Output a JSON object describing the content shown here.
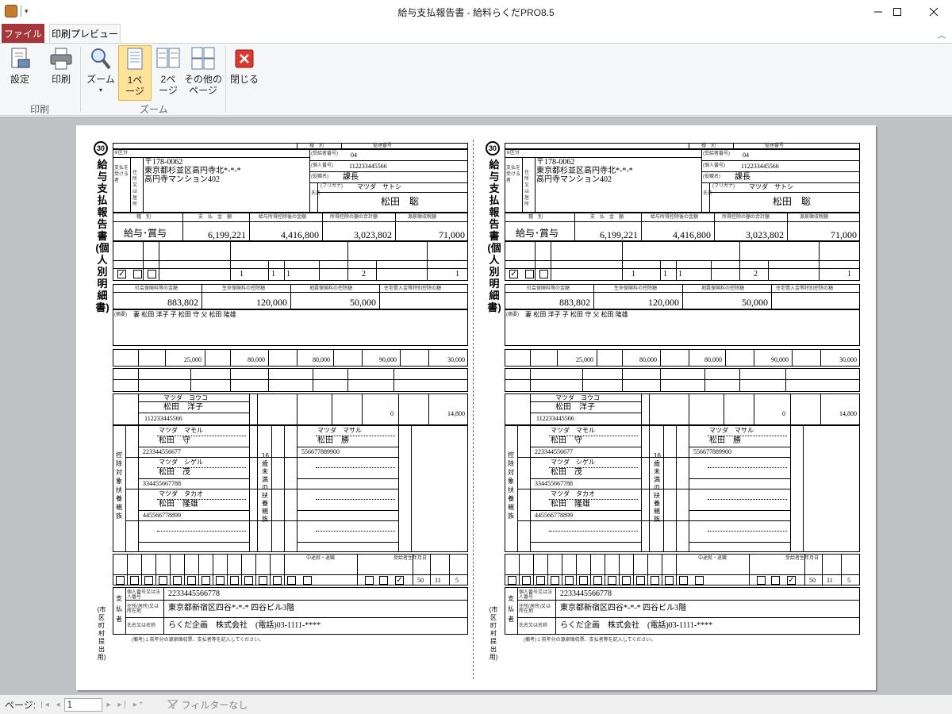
{
  "window": {
    "title": "給与支払報告書 - 給料らくだPRO8.5"
  },
  "tabs": {
    "file": "ファイル",
    "preview": "印刷プレビュー"
  },
  "ribbon": {
    "buttons": {
      "setup": "設定",
      "print": "印刷",
      "zoom": "ズーム",
      "one_page": "1ペ\nージ",
      "two_pages": "2ペ\nージ",
      "other_pages": "その他の\nページ",
      "close": "閉じる"
    },
    "groups": {
      "print": "印刷",
      "zoom": "ズーム"
    }
  },
  "statusbar": {
    "page_label": "ページ:",
    "page_value": "1",
    "filter": "フィルターなし"
  },
  "report": {
    "form_number": "30",
    "title": "給与支払報告書(個人別明細書)",
    "side_label": "(市区町村提出用)",
    "header_cols": {
      "c1": "種　別",
      "c2": "整理番号"
    },
    "labels": {
      "kubun": "※区分",
      "recipient_side": "支払を受ける者",
      "address": "住所又は居所",
      "beneficiary_no": "(受給者番号)",
      "individual_no": "(個人番号)",
      "position": "(役職名)",
      "name": "氏名",
      "furigana": "(フリガナ)"
    },
    "recipient": {
      "zip": "〒178-0062",
      "address1": "東京都杉並区高円寺北*-*-*",
      "address2": "高円寺マンション402",
      "beneficiary_no": "04",
      "individual_no": "112233445566",
      "position": "課長",
      "furigana": "マツダ　サトシ",
      "name": "松田　聡"
    },
    "amount_headers": {
      "type": "種　別",
      "payment": "支　払　金　額",
      "after_deduction": "給与所得控除後の金額",
      "deduction_total": "所得控除の額の合計額",
      "withholding": "源泉徴収税額"
    },
    "amounts": {
      "type": "給与･賞与",
      "payment": "6,199,221",
      "after_deduction": "4,416,800",
      "deduction_total": "3,023,802",
      "withholding": "71,000"
    },
    "dependent_counts": {
      "c1": "1",
      "c2": "1",
      "c3": "1",
      "c4": "2",
      "c5": "1"
    },
    "insurance_headers": {
      "social": "社会保険料等の金額",
      "life": "生命保険料の控除額",
      "earthquake": "地震保険料の控除額",
      "housing": "住宅借入金等特別控除の額"
    },
    "insurance": {
      "social": "883,802",
      "life": "120,000",
      "earthquake": "50,000"
    },
    "remarks_label": "(摘要)",
    "remarks": "妻 松田 洋子 子 松田 守 父 松田 隆雄",
    "life_breakdown": {
      "v1": "25,000",
      "v2": "80,000",
      "v3": "80,000",
      "v4": "90,000",
      "v5": "30,000"
    },
    "spouse": {
      "furigana": "マツダ　ヨウコ",
      "name": "松田　洋子",
      "individual_no": "112233445566",
      "spouse_income": "0",
      "national_pension": "14,800"
    },
    "section_labels": {
      "deps": "控除対象扶養親族",
      "under16": "16歳未満の扶養親族"
    },
    "dependents": [
      {
        "furigana": "マツダ　マモル",
        "name": "松田　守",
        "individual_no": "223344556677"
      },
      {
        "furigana": "マツダ　シゲル",
        "name": "松田　茂",
        "individual_no": "334455667788"
      },
      {
        "furigana": "マツダ　タカオ",
        "name": "松田　隆雄",
        "individual_no": "445566778899"
      },
      {
        "furigana": "",
        "name": "",
        "individual_no": ""
      }
    ],
    "children": [
      {
        "furigana": "マツダ　マサル",
        "name": "松田　勝",
        "individual_no": "556677889900"
      },
      {
        "furigana": "",
        "name": "",
        "individual_no": ""
      },
      {
        "furigana": "",
        "name": "",
        "individual_no": ""
      },
      {
        "furigana": "",
        "name": "",
        "individual_no": ""
      }
    ],
    "bottom_headers": {
      "job": "中途就・退職",
      "birth": "受給者生年月日"
    },
    "birth": {
      "year": "50",
      "month": "11",
      "day": "5"
    },
    "payer": {
      "label": "支払者",
      "number_label": "個人番号又は法人番号",
      "number": "2233445566778",
      "address_label": "住所(居所)又は所在地",
      "address": "東京都新宿区四谷*-*-* 四谷ビル3階",
      "name_label": "氏名又は名称",
      "name": "らくだ企画　株式会社　(電話)03-1111-****"
    },
    "footnote": "(備考) 1 前年分の源泉徴収票、支払者等を記入してください。"
  }
}
